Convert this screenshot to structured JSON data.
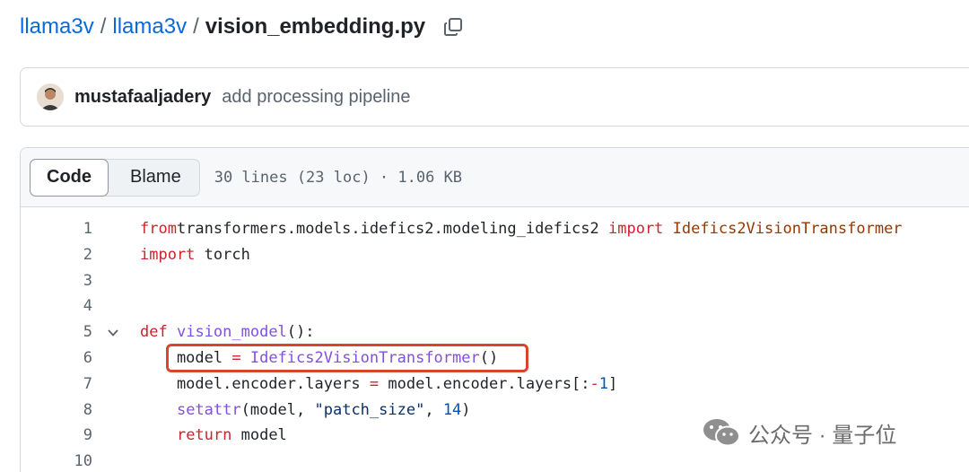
{
  "breadcrumb": {
    "repo_owner": "llama3v",
    "repo_name": "llama3v",
    "separator": "/",
    "file_name": "vision_embedding.py"
  },
  "commit": {
    "author": "mustafaaljadery",
    "message": "add processing pipeline"
  },
  "file_header": {
    "tab_code": "Code",
    "tab_blame": "Blame",
    "meta": "30 lines (23 loc) · 1.06 KB"
  },
  "code_lines": [
    {
      "n": "1",
      "tokens": [
        [
          "kw",
          "from"
        ],
        [
          "",
          "transformers.models.idefics2.modeling_idefics2 "
        ],
        [
          "kw",
          "import"
        ],
        [
          "",
          " "
        ],
        [
          "nm",
          "Idefics2VisionTransformer"
        ]
      ]
    },
    {
      "n": "2",
      "tokens": [
        [
          "kw",
          "import"
        ],
        [
          "",
          " torch"
        ]
      ]
    },
    {
      "n": "3",
      "tokens": []
    },
    {
      "n": "4",
      "tokens": []
    },
    {
      "n": "5",
      "tokens": [
        [
          "kw",
          "def"
        ],
        [
          "",
          " "
        ],
        [
          "fn",
          "vision_model"
        ],
        [
          "",
          "():"
        ]
      ]
    },
    {
      "n": "6",
      "tokens": [
        [
          "",
          "    model "
        ],
        [
          "kw",
          "="
        ],
        [
          "",
          " "
        ],
        [
          "fn",
          "Idefics2VisionTransformer"
        ],
        [
          "",
          "()"
        ]
      ]
    },
    {
      "n": "7",
      "tokens": [
        [
          "",
          "    model.encoder.layers "
        ],
        [
          "kw",
          "="
        ],
        [
          "",
          " model.encoder.layers[:"
        ],
        [
          "kw",
          "-"
        ],
        [
          "num",
          "1"
        ],
        [
          "",
          "]"
        ]
      ]
    },
    {
      "n": "8",
      "tokens": [
        [
          "",
          "    "
        ],
        [
          "fn",
          "setattr"
        ],
        [
          "",
          "(model, "
        ],
        [
          "str",
          "\"patch_size\""
        ],
        [
          "",
          ", "
        ],
        [
          "num",
          "14"
        ],
        [
          "",
          ")"
        ]
      ]
    },
    {
      "n": "9",
      "tokens": [
        [
          "",
          "    "
        ],
        [
          "kw",
          "return"
        ],
        [
          "",
          " model"
        ]
      ]
    },
    {
      "n": "10",
      "tokens": []
    }
  ],
  "watermark": {
    "text": "公众号 · 量子位"
  },
  "colors": {
    "link": "#0969da",
    "keyword": "#cf222e",
    "function": "#8250df",
    "string": "#0a3069",
    "highlight_box": "#d9442f"
  }
}
